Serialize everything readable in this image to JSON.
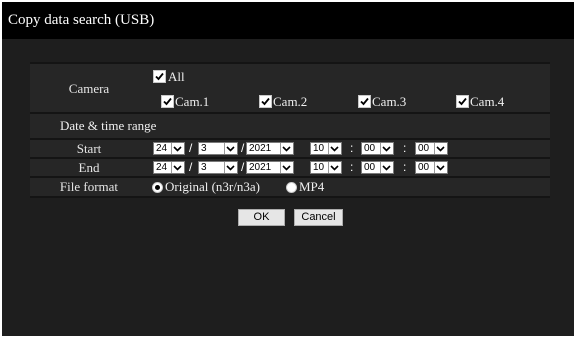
{
  "title": "Copy data search (USB)",
  "camera": {
    "label": "Camera",
    "all": {
      "label": "All",
      "checked": true
    },
    "cams": [
      {
        "label": "Cam.1",
        "checked": true
      },
      {
        "label": "Cam.2",
        "checked": true
      },
      {
        "label": "Cam.3",
        "checked": true
      },
      {
        "label": "Cam.4",
        "checked": true
      }
    ]
  },
  "date_range": {
    "label": "Date & time range",
    "start": {
      "label": "Start",
      "day": "24",
      "month": "3",
      "year": "2021",
      "hour": "10",
      "minute": "00",
      "second": "00"
    },
    "end": {
      "label": "End",
      "day": "24",
      "month": "3",
      "year": "2021",
      "hour": "10",
      "minute": "00",
      "second": "00"
    },
    "date_sep": "/",
    "time_sep": ":"
  },
  "file_format": {
    "label": "File format",
    "options": [
      {
        "label": "Original (n3r/n3a)",
        "selected": true
      },
      {
        "label": "MP4",
        "selected": false
      }
    ]
  },
  "buttons": {
    "ok": "OK",
    "cancel": "Cancel"
  },
  "colors": {
    "background": "#1e1e1e",
    "titlebar": "#000000",
    "panel": "#262626"
  }
}
